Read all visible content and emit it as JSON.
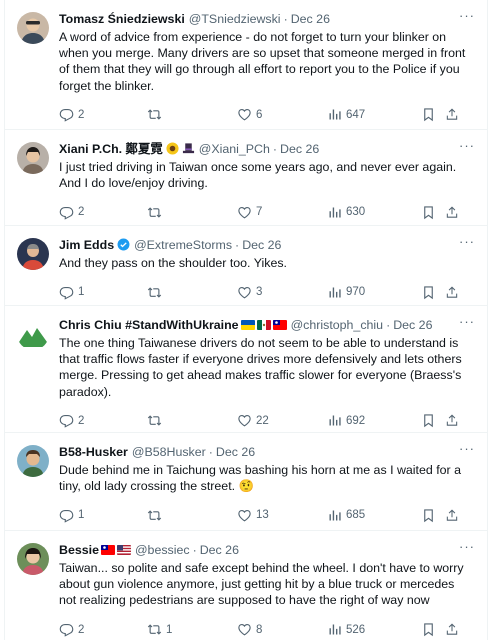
{
  "colors": {
    "text": "#0f1419",
    "muted": "#536471",
    "border": "#eff3f4",
    "verified": "#1d9bf0"
  },
  "tweets": [
    {
      "name": "Tomasz Śniedziewski",
      "handle": "@TSniedziewski",
      "date": "Dec 26",
      "text": "A word of advice from experience - do not forget to turn your blinker on when you merge. Many drivers are so upset that someone merged in front of them that they will go through all effort to report you to the Police if you forget the blinker.",
      "replies": "2",
      "retweets": "",
      "likes": "6",
      "views": "647"
    },
    {
      "name": "Xiani P.Ch. 鄭夏霓",
      "handle": "@Xiani_PCh",
      "date": "Dec 26",
      "text": "I just tried driving in Taiwan once some years ago, and never ever again. And I do love/enjoy driving.",
      "replies": "2",
      "retweets": "",
      "likes": "7",
      "views": "630"
    },
    {
      "name": "Jim Edds",
      "handle": "@ExtremeStorms",
      "date": "Dec 26",
      "text": "And they pass on the shoulder too. Yikes.",
      "replies": "1",
      "retweets": "",
      "likes": "3",
      "views": "970"
    },
    {
      "name": "Chris Chiu #StandWithUkraine",
      "handle": "@christoph_chiu",
      "date": "Dec 26",
      "text": "The one thing Taiwanese drivers do not seem to be able to understand is that traffic flows faster if everyone drives more defensively and lets others merge. Pressing to get ahead makes traffic slower for everyone (Braess's paradox).",
      "replies": "2",
      "retweets": "",
      "likes": "22",
      "views": "692"
    },
    {
      "name": "B58-Husker",
      "handle": "@B58Husker",
      "date": "Dec 26",
      "text": "Dude behind me in Taichung was bashing his horn at me as I waited for a tiny, old lady crossing the street. 🤨",
      "replies": "1",
      "retweets": "",
      "likes": "13",
      "views": "685"
    },
    {
      "name": "Bessie",
      "handle": "@bessiec",
      "date": "Dec 26",
      "text": "Taiwan... so polite and safe except behind the wheel. I don't have to worry about gun violence anymore, just getting hit by a blue truck or mercedes not realizing pedestrians are supposed to have the right of way now",
      "replies": "2",
      "retweets": "1",
      "likes": "8",
      "views": "526"
    }
  ]
}
